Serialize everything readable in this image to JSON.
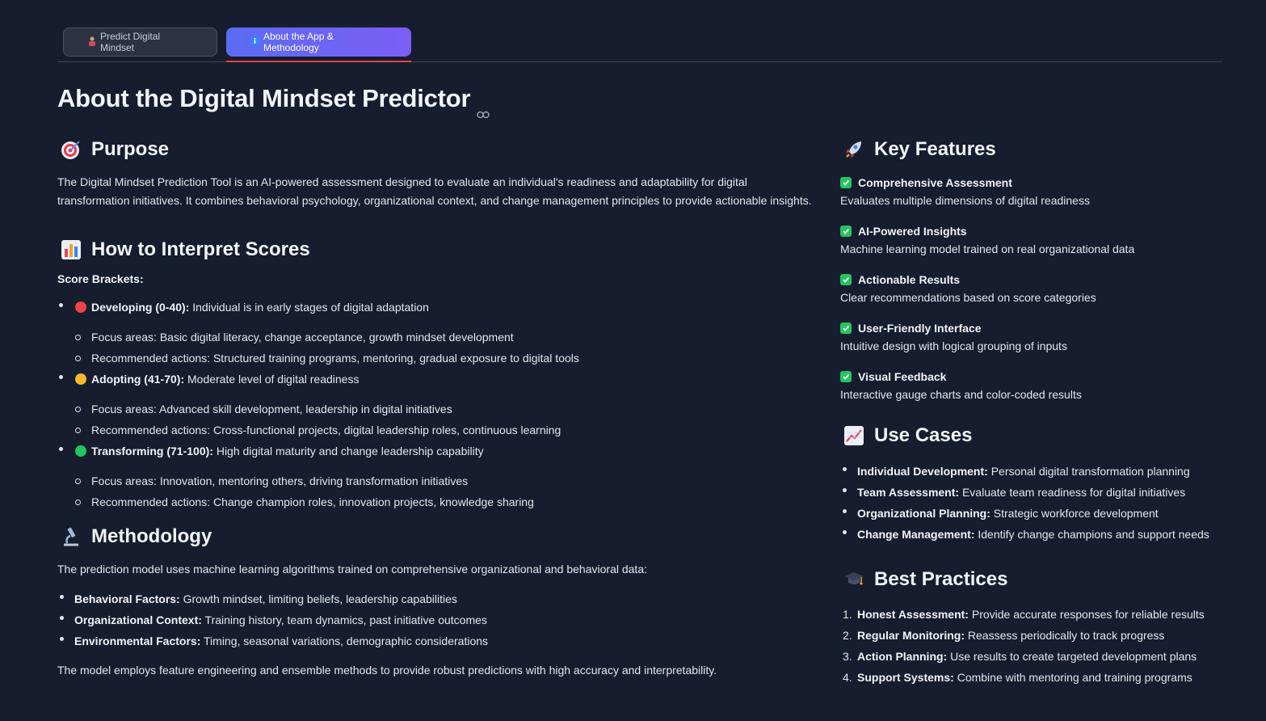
{
  "tabs": [
    {
      "label": "Predict Digital Mindset",
      "icon": "person-icon"
    },
    {
      "label": "About the App & Methodology",
      "icon": "info-icon"
    }
  ],
  "page_title": "About the Digital Mindset Predictor",
  "purpose": {
    "heading": "Purpose",
    "text": "The Digital Mindset Prediction Tool is an AI-powered assessment designed to evaluate an individual's readiness and adaptability for digital transformation initiatives. It combines behavioral psychology, organizational context, and change management principles to provide actionable insights."
  },
  "interpret": {
    "heading": "How to Interpret Scores",
    "subheading": "Score Brackets:",
    "brackets": [
      {
        "label": "Developing (0-40):",
        "desc": "Individual is in early stages of digital adaptation",
        "color": "#ef4444",
        "focus": "Focus areas: Basic digital literacy, change acceptance, growth mindset development",
        "actions": "Recommended actions: Structured training programs, mentoring, gradual exposure to digital tools"
      },
      {
        "label": "Adopting (41-70):",
        "desc": "Moderate level of digital readiness",
        "color": "#f5b82e",
        "focus": "Focus areas: Advanced skill development, leadership in digital initiatives",
        "actions": "Recommended actions: Cross-functional projects, digital leadership roles, continuous learning"
      },
      {
        "label": "Transforming (71-100):",
        "desc": "High digital maturity and change leadership capability",
        "color": "#22c55e",
        "focus": "Focus areas: Innovation, mentoring others, driving transformation initiatives",
        "actions": "Recommended actions: Change champion roles, innovation projects, knowledge sharing"
      }
    ]
  },
  "methodology": {
    "heading": "Methodology",
    "intro": "The prediction model uses machine learning algorithms trained on comprehensive organizational and behavioral data:",
    "factors": [
      {
        "label": "Behavioral Factors:",
        "desc": "Growth mindset, limiting beliefs, leadership capabilities"
      },
      {
        "label": "Organizational Context:",
        "desc": "Training history, team dynamics, past initiative outcomes"
      },
      {
        "label": "Environmental Factors:",
        "desc": "Timing, seasonal variations, demographic considerations"
      }
    ],
    "outro": "The model employs feature engineering and ensemble methods to provide robust predictions with high accuracy and interpretability."
  },
  "features": {
    "heading": "Key Features",
    "items": [
      {
        "title": "Comprehensive Assessment",
        "desc": "Evaluates multiple dimensions of digital readiness"
      },
      {
        "title": "AI-Powered Insights",
        "desc": "Machine learning model trained on real organizational data"
      },
      {
        "title": "Actionable Results",
        "desc": "Clear recommendations based on score categories"
      },
      {
        "title": "User-Friendly Interface",
        "desc": "Intuitive design with logical grouping of inputs"
      },
      {
        "title": "Visual Feedback",
        "desc": "Interactive gauge charts and color-coded results"
      }
    ]
  },
  "use_cases": {
    "heading": "Use Cases",
    "items": [
      {
        "label": "Individual Development:",
        "desc": "Personal digital transformation planning"
      },
      {
        "label": "Team Assessment:",
        "desc": "Evaluate team readiness for digital initiatives"
      },
      {
        "label": "Organizational Planning:",
        "desc": "Strategic workforce development"
      },
      {
        "label": "Change Management:",
        "desc": "Identify change champions and support needs"
      }
    ]
  },
  "best_practices": {
    "heading": "Best Practices",
    "items": [
      {
        "num": "1.",
        "label": "Honest Assessment:",
        "desc": "Provide accurate responses for reliable results"
      },
      {
        "num": "2.",
        "label": "Regular Monitoring:",
        "desc": "Reassess periodically to track progress"
      },
      {
        "num": "3.",
        "label": "Action Planning:",
        "desc": "Use results to create targeted development plans"
      },
      {
        "num": "4.",
        "label": "Support Systems:",
        "desc": "Combine with mentoring and training programs"
      }
    ]
  },
  "colors": {
    "background": "#151d2e",
    "accent": "#6366f1",
    "tab_underline": "#ef4444",
    "check": "#22c55e"
  }
}
